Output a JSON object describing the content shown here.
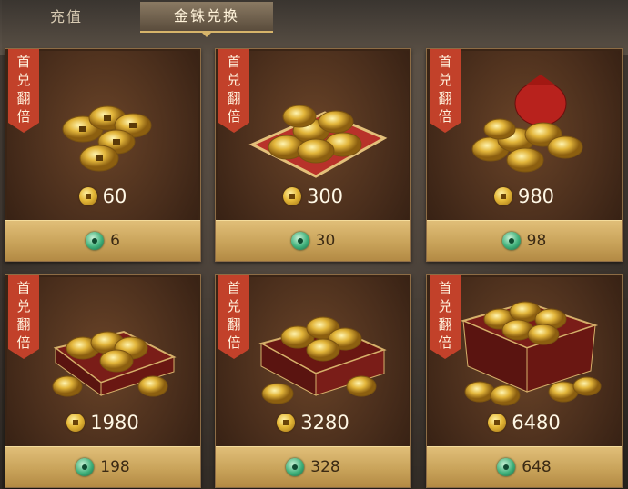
{
  "tabs": {
    "recharge": "充值",
    "exchange": "金铢兑换"
  },
  "ribbon_chars": [
    "首",
    "兑",
    "翻",
    "倍"
  ],
  "items": [
    {
      "gold": "60",
      "price": "6"
    },
    {
      "gold": "300",
      "price": "30"
    },
    {
      "gold": "980",
      "price": "98"
    },
    {
      "gold": "1980",
      "price": "198"
    },
    {
      "gold": "3280",
      "price": "328"
    },
    {
      "gold": "6480",
      "price": "648"
    }
  ],
  "colors": {
    "ribbon": "#c2412a",
    "price_bar": "#c9a35a",
    "gold_text": "#fff8e6",
    "selected_tab_underline": "#d6b46a"
  },
  "icons": {
    "currency": "gold-coin-icon",
    "price": "jade-coin-icon"
  }
}
